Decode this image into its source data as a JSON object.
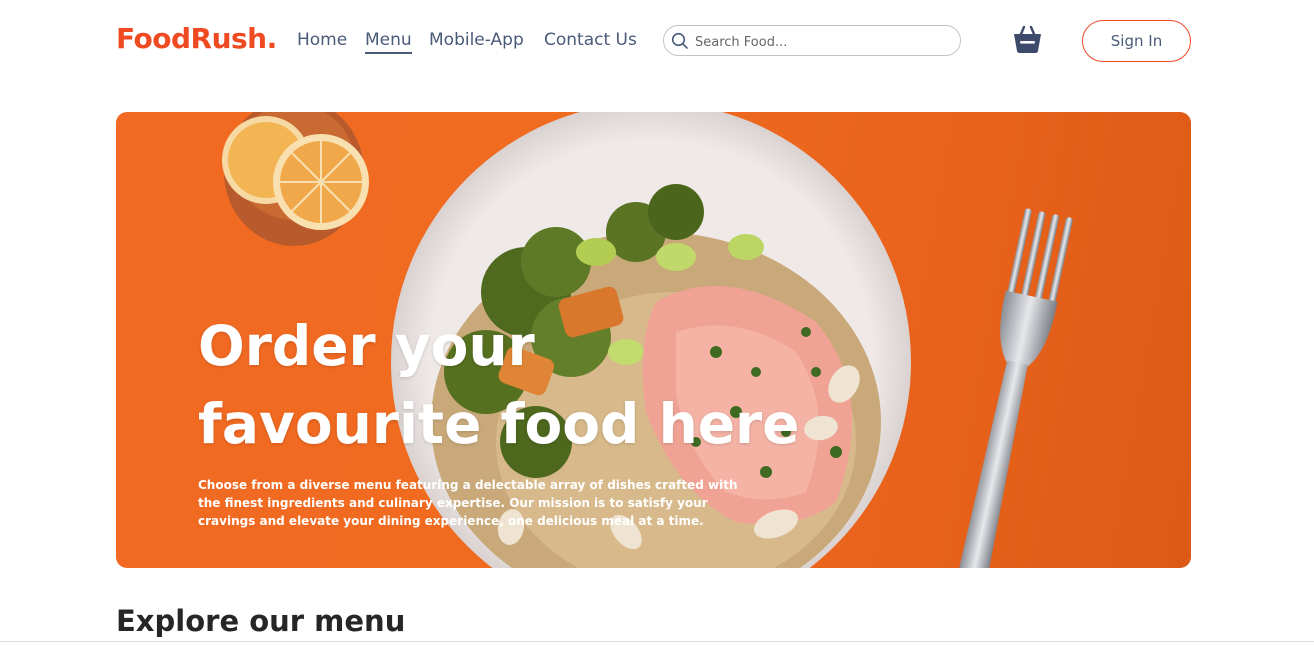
{
  "brand": {
    "logo": "FoodRush."
  },
  "nav": {
    "links": [
      {
        "label": "Home",
        "active": false
      },
      {
        "label": "Menu",
        "active": true
      },
      {
        "label": "Mobile-App",
        "active": false
      },
      {
        "label": "Contact Us",
        "active": false
      }
    ]
  },
  "search": {
    "placeholder": "Search Food..."
  },
  "header": {
    "cart_icon": "basket-icon",
    "signin_label": "Sign In"
  },
  "hero": {
    "title_line1": "Order your",
    "title_line2": "favourite food here",
    "description": "Choose from a diverse menu featuring a delectable array of dishes crafted with the finest ingredients and culinary expertise. Our mission is to satisfy your cravings and elevate your dining experience, one delicious meal at a time."
  },
  "explore": {
    "title": "Explore our menu"
  },
  "colors": {
    "accent": "#f04a23",
    "nav_text": "#4a5a79",
    "hero_bg": "#ef6a1f"
  }
}
